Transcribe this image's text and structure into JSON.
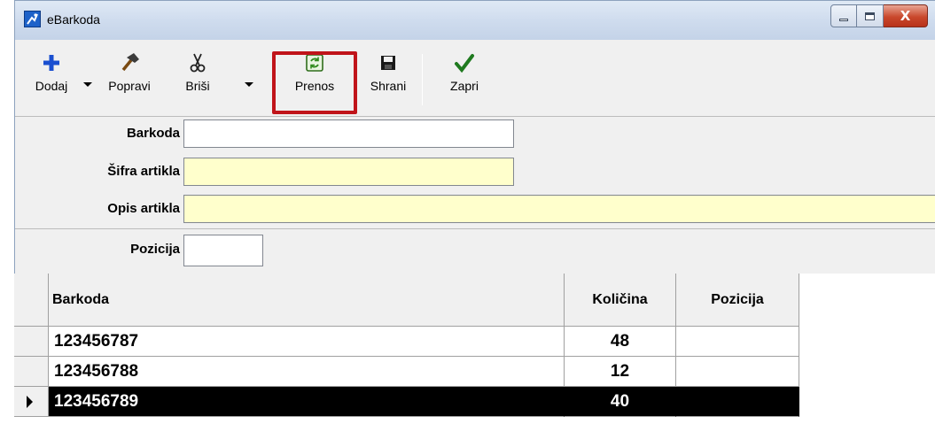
{
  "window": {
    "title": "eBarkoda",
    "controls": {
      "minimize": "–",
      "maximize": "□",
      "close": "X"
    }
  },
  "toolbar": {
    "buttons": [
      {
        "label": "Dodaj",
        "icon": "plus-icon",
        "has_dropdown": true
      },
      {
        "label": "Popravi",
        "icon": "hammer-icon",
        "has_dropdown": false
      },
      {
        "label": "Briši",
        "icon": "scissors-icon",
        "has_dropdown": true
      },
      {
        "label": "Prenos",
        "icon": "transfer-icon",
        "has_dropdown": false,
        "highlighted": true
      },
      {
        "label": "Shrani",
        "icon": "floppy-disk-icon",
        "has_dropdown": false
      },
      {
        "label": "Zapri",
        "icon": "checkmark-icon",
        "has_dropdown": false
      }
    ]
  },
  "form": {
    "barkoda": {
      "label": "Barkoda",
      "value": ""
    },
    "sifra_artikla": {
      "label": "Šifra artikla",
      "value": ""
    },
    "opis_artikla": {
      "label": "Opis artikla",
      "value": ""
    },
    "pozicija": {
      "label": "Pozicija",
      "value": ""
    }
  },
  "grid": {
    "columns": [
      "Barkoda",
      "Količina",
      "Pozicija"
    ],
    "rows": [
      {
        "barkoda": "123456787",
        "kolicina": "48",
        "pozicija": "",
        "selected": false
      },
      {
        "barkoda": "123456788",
        "kolicina": "12",
        "pozicija": "",
        "selected": false
      },
      {
        "barkoda": "123456789",
        "kolicina": "40",
        "pozicija": "",
        "selected": true
      }
    ]
  },
  "colors": {
    "input_yellow": "#ffffcc",
    "highlight_red": "#c0141a",
    "selected_row": "#000000",
    "window_bg": "#f0f0f0"
  }
}
